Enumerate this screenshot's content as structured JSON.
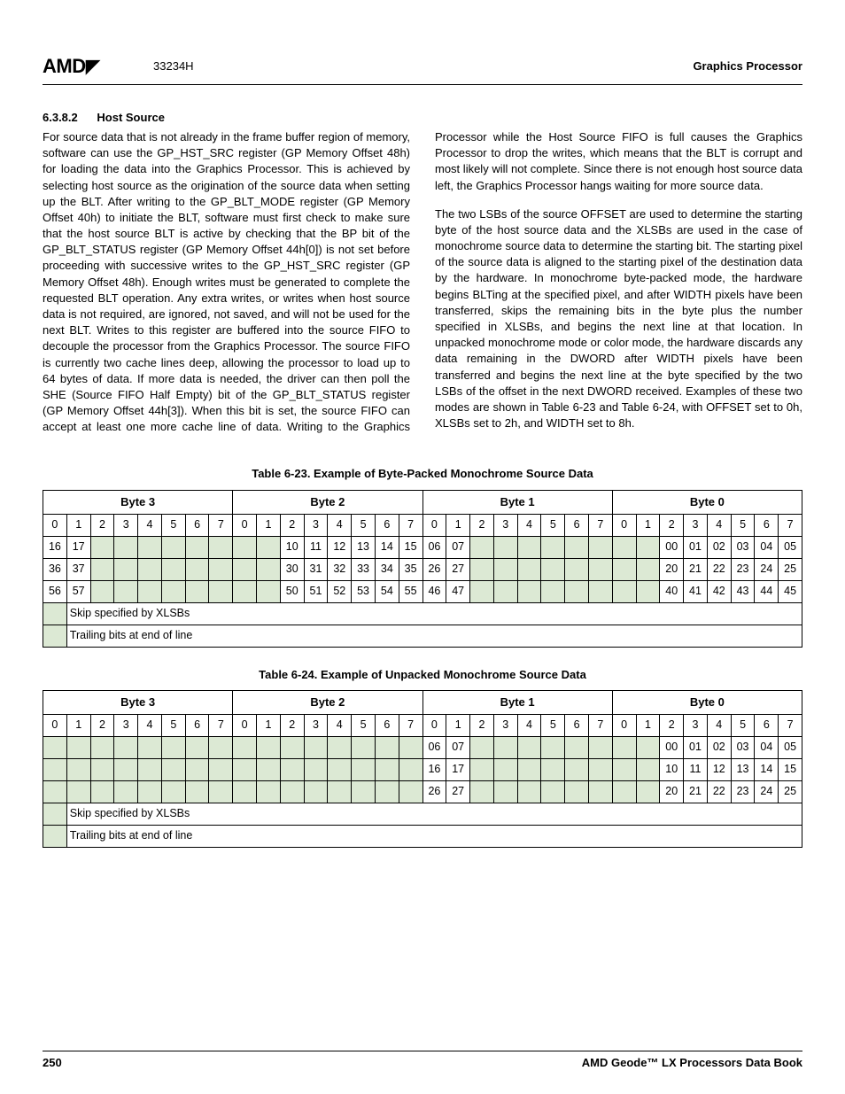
{
  "header": {
    "logo": "AMD",
    "doc_id": "33234H",
    "right": "Graphics Processor"
  },
  "section": {
    "number": "6.3.8.2",
    "title": "Host Source"
  },
  "paragraphs": {
    "p1": "For source data that is not already in the frame buffer region of memory, software can use the GP_HST_SRC register (GP Memory Offset 48h) for loading the data into the Graphics Processor. This is achieved by selecting host source as the origination of the source data when setting up the BLT. After writing to the GP_BLT_MODE register (GP Memory Offset 40h) to initiate the BLT, software must first check to make sure that the host source BLT is active by checking that the BP bit of the GP_BLT_STATUS register (GP Memory Offset 44h[0]) is not set before proceeding with successive writes to the GP_HST_SRC register (GP Memory Offset 48h). Enough writes must be generated to complete the requested BLT operation. Any extra writes, or writes when host source data is not required, are ignored, not saved, and will not be used for the next BLT. Writes to this register are buffered into the source FIFO to decouple the processor from the Graphics Processor. The source FIFO is currently two cache lines deep, allowing the processor to load up to 64 bytes of data. If more data is needed, the driver can then poll the SHE (Source FIFO Half Empty) bit of the GP_BLT_STATUS register (GP Memory Offset 44h[3]). When this bit is set, the source FIFO can accept at least one more cache line of data. Writing to the Graphics Processor while the Host Source FIFO is full causes the Graphics Processor to drop the writes, which means that the BLT is corrupt and most likely will not complete. Since there is not enough host source data left, the Graphics Processor hangs waiting for more source data.",
    "p2": "The two LSBs of the source OFFSET are used to determine the starting byte of the host source data and the XLSBs are used in the case of monochrome source data to determine the starting bit. The starting pixel of the source data is aligned to the starting pixel of the destination data by the hardware. In monochrome byte-packed mode, the hardware begins BLTing at the specified pixel, and after WIDTH pixels have been transferred, skips the remaining bits in the byte plus the number specified in XLSBs, and begins the next line at that location. In unpacked monochrome mode or color mode, the hardware discards any data remaining in the DWORD after WIDTH pixels have been transferred and begins the next line at the byte specified by the two LSBs of the offset in the next DWORD received. Examples of these two modes are shown in Table 6-23 and Table 6-24, with OFFSET set to 0h, XLSBs set to 2h, and WIDTH set to 8h."
  },
  "table23": {
    "caption": "Table 6-23.  Example of Byte-Packed Monochrome Source Data",
    "byte_headers": [
      "Byte 3",
      "Byte 2",
      "Byte 1",
      "Byte 0"
    ],
    "bit_headers": [
      "0",
      "1",
      "2",
      "3",
      "4",
      "5",
      "6",
      "7",
      "0",
      "1",
      "2",
      "3",
      "4",
      "5",
      "6",
      "7",
      "0",
      "1",
      "2",
      "3",
      "4",
      "5",
      "6",
      "7",
      "0",
      "1",
      "2",
      "3",
      "4",
      "5",
      "6",
      "7"
    ],
    "row1": [
      "16",
      "17",
      "",
      "",
      "",
      "",
      "",
      "",
      "",
      "",
      "10",
      "11",
      "12",
      "13",
      "14",
      "15",
      "06",
      "07",
      "",
      "",
      "",
      "",
      "",
      "",
      "",
      "",
      "00",
      "01",
      "02",
      "03",
      "04",
      "05"
    ],
    "row2": [
      "36",
      "37",
      "",
      "",
      "",
      "",
      "",
      "",
      "",
      "",
      "30",
      "31",
      "32",
      "33",
      "34",
      "35",
      "26",
      "27",
      "",
      "",
      "",
      "",
      "",
      "",
      "",
      "",
      "20",
      "21",
      "22",
      "23",
      "24",
      "25"
    ],
    "row3": [
      "56",
      "57",
      "",
      "",
      "",
      "",
      "",
      "",
      "",
      "",
      "50",
      "51",
      "52",
      "53",
      "54",
      "55",
      "46",
      "47",
      "",
      "",
      "",
      "",
      "",
      "",
      "",
      "",
      "40",
      "41",
      "42",
      "43",
      "44",
      "45"
    ],
    "note1": "Skip specified by XLSBs",
    "note2": "Trailing bits at end of line"
  },
  "table24": {
    "caption": "Table 6-24.  Example of Unpacked Monochrome Source Data",
    "byte_headers": [
      "Byte 3",
      "Byte 2",
      "Byte 1",
      "Byte 0"
    ],
    "bit_headers": [
      "0",
      "1",
      "2",
      "3",
      "4",
      "5",
      "6",
      "7",
      "0",
      "1",
      "2",
      "3",
      "4",
      "5",
      "6",
      "7",
      "0",
      "1",
      "2",
      "3",
      "4",
      "5",
      "6",
      "7",
      "0",
      "1",
      "2",
      "3",
      "4",
      "5",
      "6",
      "7"
    ],
    "row1": [
      "",
      "",
      "",
      "",
      "",
      "",
      "",
      "",
      "",
      "",
      "",
      "",
      "",
      "",
      "",
      "",
      "06",
      "07",
      "",
      "",
      "",
      "",
      "",
      "",
      "",
      "",
      "00",
      "01",
      "02",
      "03",
      "04",
      "05"
    ],
    "row2": [
      "",
      "",
      "",
      "",
      "",
      "",
      "",
      "",
      "",
      "",
      "",
      "",
      "",
      "",
      "",
      "",
      "16",
      "17",
      "",
      "",
      "",
      "",
      "",
      "",
      "",
      "",
      "10",
      "11",
      "12",
      "13",
      "14",
      "15"
    ],
    "row3": [
      "",
      "",
      "",
      "",
      "",
      "",
      "",
      "",
      "",
      "",
      "",
      "",
      "",
      "",
      "",
      "",
      "26",
      "27",
      "",
      "",
      "",
      "",
      "",
      "",
      "",
      "",
      "20",
      "21",
      "22",
      "23",
      "24",
      "25"
    ],
    "note1": "Skip specified by XLSBs",
    "note2": "Trailing bits at end of line"
  },
  "footer": {
    "page": "250",
    "book": "AMD Geode™ LX Processors Data Book"
  }
}
